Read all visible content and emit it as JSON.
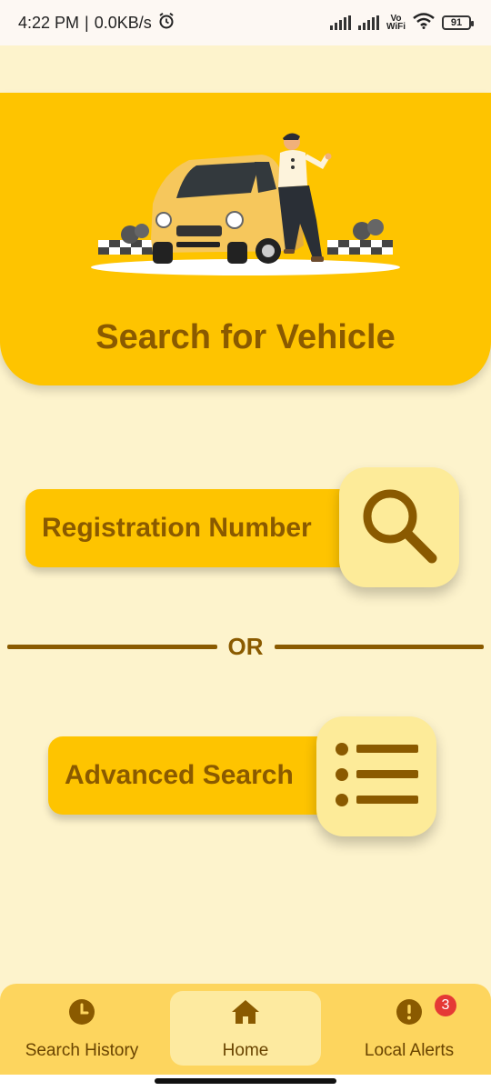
{
  "status_bar": {
    "time": "4:22 PM",
    "separator": "|",
    "speed": "0.0KB/s",
    "alarm_icon": "alarm-icon",
    "vo_wifi_top": "Vo",
    "vo_wifi_bottom": "WiFi",
    "battery": "91"
  },
  "hero": {
    "title": "Search for Vehicle",
    "illustration": "car-with-man-illustration"
  },
  "search_options": {
    "registration_label": "Registration Number",
    "registration_icon": "magnifier-icon",
    "divider_text": "OR",
    "advanced_label": "Advanced Search",
    "advanced_icon": "list-icon"
  },
  "bottom_nav": {
    "items": [
      {
        "label": "Search History",
        "icon": "clock-icon"
      },
      {
        "label": "Home",
        "icon": "home-icon",
        "active": true
      },
      {
        "label": "Local Alerts",
        "icon": "alert-icon",
        "badge": "3"
      }
    ]
  },
  "colors": {
    "background": "#fdf3cc",
    "accent": "#fec400",
    "text_brown": "#8a5a00",
    "icon_card": "#fdeb99",
    "nav_bg": "#fdd55e",
    "badge": "#e53935"
  }
}
